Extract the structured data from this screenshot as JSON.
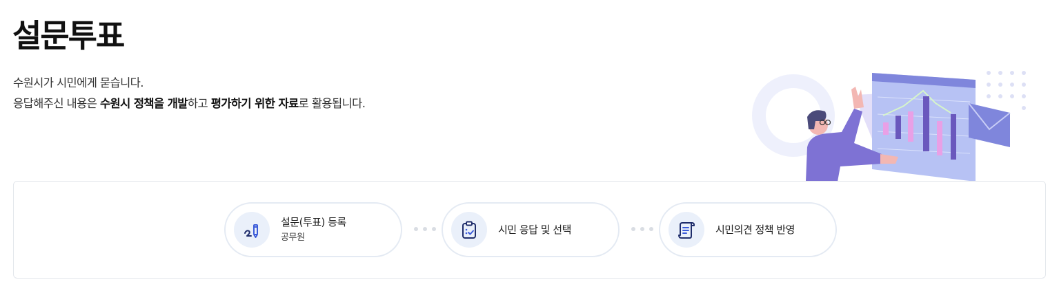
{
  "page": {
    "title": "설문투표",
    "intro_line1": "수원시가 시민에게 묻습니다.",
    "intro_line2": {
      "part1": "응답해주신 내용은 ",
      "bold1": "수원시 정책을 개발",
      "part2": "하고 ",
      "bold2": "평가하기 위한 자료",
      "part3": "로 활용됩니다."
    }
  },
  "process": {
    "steps": [
      {
        "title": "설문(투표) 등록",
        "subtitle": "공무원",
        "icon": "pen-icon"
      },
      {
        "title": "시민 응답 및 선택",
        "subtitle": "",
        "icon": "clipboard-check-icon"
      },
      {
        "title": "시민의견 정책 반영",
        "subtitle": "",
        "icon": "scroll-document-icon"
      }
    ]
  },
  "colors": {
    "accent_blue": "#3b5bd9",
    "icon_bg": "#eaf0fa",
    "border": "#e4eaf3",
    "illustration_purple": "#8477d6"
  }
}
